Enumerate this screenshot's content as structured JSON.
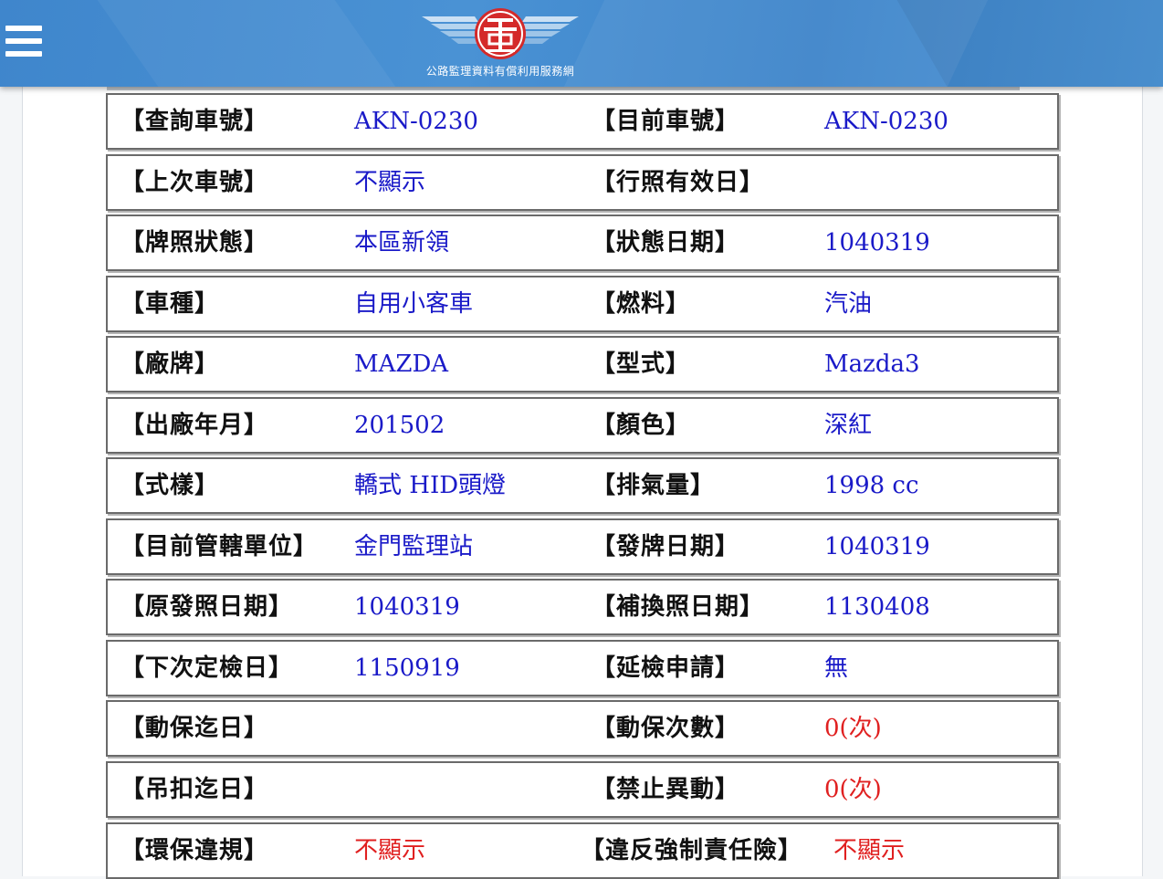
{
  "header": {
    "site_name": "公路監理資料有償利用服務網",
    "menu_icon": "hamburger-menu-icon",
    "logo_icon": "winged-emblem-logo-icon",
    "colors": {
      "header_bg": "#4a92d4",
      "value_blue": "#1a1ac8",
      "value_red": "#e02020",
      "logo_red": "#d42a2a"
    }
  },
  "rows": [
    {
      "l1": "【查詢車號】",
      "v1": "AKN-0230",
      "l2": "【目前車號】",
      "v2": "AKN-0230"
    },
    {
      "l1": "【上次車號】",
      "v1": "不顯示",
      "l2": "【行照有效日】",
      "v2": ""
    },
    {
      "l1": "【牌照狀態】",
      "v1": "本區新領",
      "l2": "【狀態日期】",
      "v2": "1040319"
    },
    {
      "l1": "【車種】",
      "v1": "自用小客車",
      "l2": "【燃料】",
      "v2": "汽油"
    },
    {
      "l1": "【廠牌】",
      "v1": "MAZDA",
      "l2": "【型式】",
      "v2": "Mazda3"
    },
    {
      "l1": "【出廠年月】",
      "v1": "201502",
      "l2": "【顏色】",
      "v2": "深紅"
    },
    {
      "l1": "【式樣】",
      "v1": "轎式 HID頭燈",
      "l2": "【排氣量】",
      "v2": "1998 cc"
    },
    {
      "l1": "【目前管轄單位】",
      "v1": "金門監理站",
      "l2": "【發牌日期】",
      "v2": "1040319"
    },
    {
      "l1": "【原發照日期】",
      "v1": "1040319",
      "l2": "【補換照日期】",
      "v2": "1130408"
    },
    {
      "l1": "【下次定檢日】",
      "v1": "1150919",
      "l2": "【延檢申請】",
      "v2": "無"
    },
    {
      "l1": "【動保迄日】",
      "v1": "",
      "l2": "【動保次數】",
      "v2": "0(次)"
    },
    {
      "l1": "【吊扣迄日】",
      "v1": "",
      "l2": "【禁止異動】",
      "v2": "0(次)"
    },
    {
      "l1": "【環保違規】",
      "v1": "不顯示",
      "l2": "【違反強制責任險】",
      "v2": "不顯示"
    }
  ]
}
